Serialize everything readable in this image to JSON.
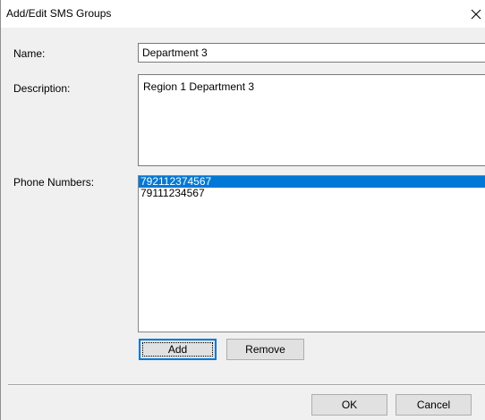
{
  "window": {
    "title": "Add/Edit SMS Groups",
    "close_glyph": "✕"
  },
  "form": {
    "name_label": "Name:",
    "name_value": "Department 3",
    "description_label": "Description:",
    "description_value": "Region 1 Department 3",
    "phones_label": "Phone Numbers:",
    "phone_numbers": [
      {
        "number": "792112374567",
        "selected": true
      },
      {
        "number": "79111234567",
        "selected": false
      }
    ]
  },
  "buttons": {
    "add": "Add",
    "remove": "Remove",
    "ok": "OK",
    "cancel": "Cancel"
  },
  "icons": {
    "close": "close-icon"
  },
  "colors": {
    "selection": "#0078d7",
    "dialog_bg": "#f0f0f0"
  }
}
